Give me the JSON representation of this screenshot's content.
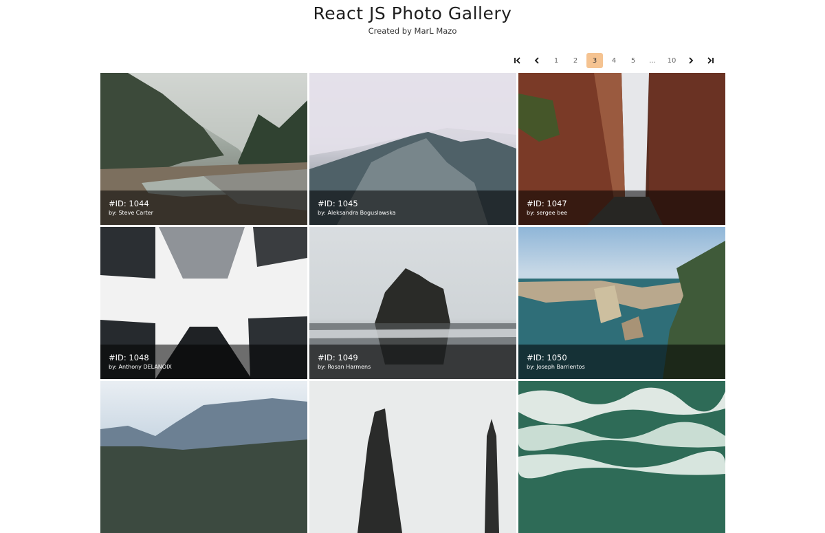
{
  "header": {
    "title": "React JS Photo Gallery",
    "subtitle": "Created by MarL Mazo"
  },
  "pagination": {
    "first_icon": "first-page-icon",
    "prev_icon": "prev-page-icon",
    "next_icon": "next-page-icon",
    "last_icon": "last-page-icon",
    "pages": [
      "1",
      "2",
      "3",
      "4",
      "5",
      "...",
      "10"
    ],
    "active": "3",
    "active_color": "#f5c391"
  },
  "photos": [
    {
      "id": "#ID: 1044",
      "author": "by: Steve Carter",
      "has_caption": true
    },
    {
      "id": "#ID: 1045",
      "author": "by: Aleksandra Boguslawska",
      "has_caption": true
    },
    {
      "id": "#ID: 1047",
      "author": "by: sergee bee",
      "has_caption": true
    },
    {
      "id": "#ID: 1048",
      "author": "by: Anthony DELANOIX",
      "has_caption": true
    },
    {
      "id": "#ID: 1049",
      "author": "by: Rosan Harmens",
      "has_caption": true
    },
    {
      "id": "#ID: 1050",
      "author": "by: Joseph Barrientos",
      "has_caption": true
    },
    {
      "has_caption": false
    },
    {
      "has_caption": false
    },
    {
      "has_caption": false
    }
  ]
}
